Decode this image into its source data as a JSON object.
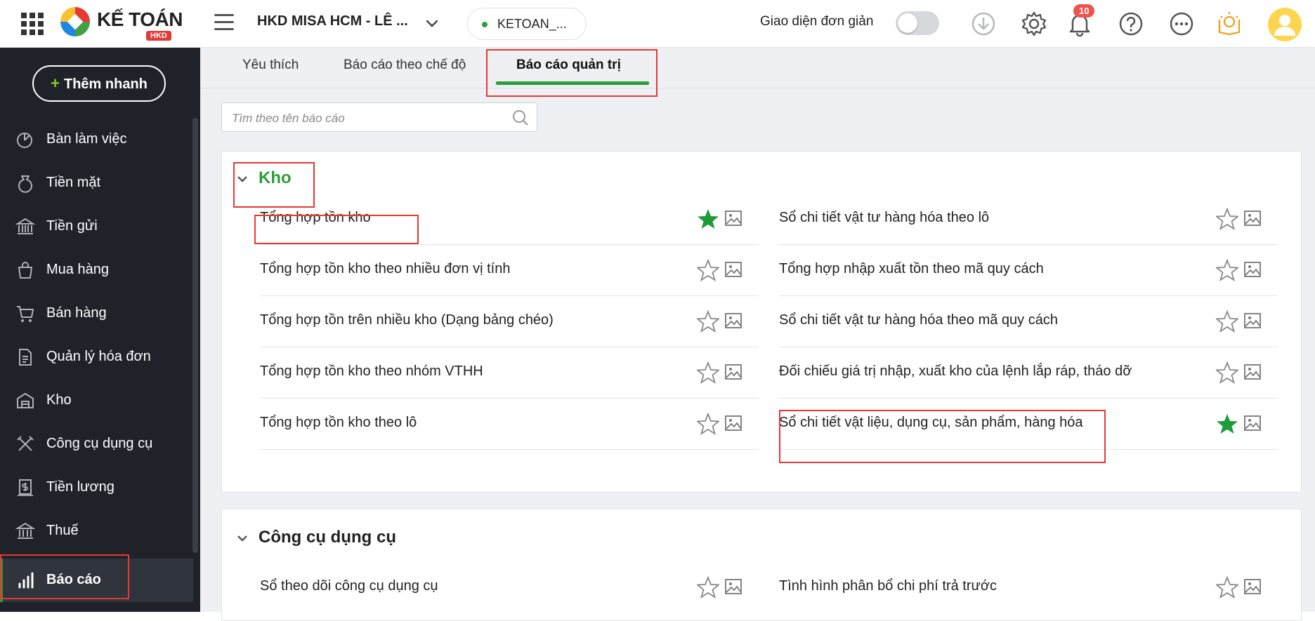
{
  "header": {
    "logo_text": "KẾ TOÁN",
    "logo_badge": "HKD",
    "company_name": "HKD MISA HCM - LÊ ...",
    "database_name": "KETOAN_...",
    "simple_mode_label": "Giao diện đơn giản",
    "notification_count": "10"
  },
  "sidebar": {
    "quick_add": "Thêm nhanh",
    "items": [
      {
        "label": "Bàn làm việc",
        "icon": "dashboard-icon"
      },
      {
        "label": "Tiền mặt",
        "icon": "cash-bag-icon"
      },
      {
        "label": "Tiền gửi",
        "icon": "bank-icon"
      },
      {
        "label": "Mua hàng",
        "icon": "shopping-bag-icon"
      },
      {
        "label": "Bán hàng",
        "icon": "cart-icon"
      },
      {
        "label": "Quản lý hóa đơn",
        "icon": "invoice-icon"
      },
      {
        "label": "Kho",
        "icon": "warehouse-icon"
      },
      {
        "label": "Công cụ dụng cụ",
        "icon": "tools-icon"
      },
      {
        "label": "Tiền lương",
        "icon": "salary-icon"
      },
      {
        "label": "Thuế",
        "icon": "tax-building-icon"
      },
      {
        "label": "Báo cáo",
        "icon": "report-chart-icon",
        "active": true
      }
    ]
  },
  "tabs": [
    {
      "label": "Yêu thích"
    },
    {
      "label": "Báo cáo theo chế độ"
    },
    {
      "label": "Báo cáo quản trị",
      "active": true
    }
  ],
  "search": {
    "placeholder": "Tìm theo tên báo cáo"
  },
  "groups": [
    {
      "title": "Kho",
      "reports_left": [
        {
          "name": "Tổng hợp tồn kho",
          "favorite": true
        },
        {
          "name": "Tổng hợp tồn kho theo nhiều đơn vị tính",
          "favorite": false
        },
        {
          "name": "Tổng hợp tồn trên nhiều kho (Dạng bảng chéo)",
          "favorite": false
        },
        {
          "name": "Tổng hợp tồn kho theo nhóm VTHH",
          "favorite": false
        },
        {
          "name": "Tổng hợp tồn kho theo lô",
          "favorite": false
        }
      ],
      "reports_right": [
        {
          "name": "Sổ chi tiết vật tư hàng hóa theo lô",
          "favorite": false
        },
        {
          "name": "Tổng hợp nhập xuất tồn theo mã quy cách",
          "favorite": false
        },
        {
          "name": "Sổ chi tiết vật tư hàng hóa theo mã quy cách",
          "favorite": false
        },
        {
          "name": "Đối chiếu giá trị nhập, xuất kho của lệnh lắp ráp, tháo dỡ",
          "favorite": false
        },
        {
          "name": "Sổ chi tiết vật liệu, dụng cụ, sản phẩm, hàng hóa",
          "favorite": true
        }
      ]
    },
    {
      "title": "Công cụ dụng cụ",
      "reports_left": [
        {
          "name": "Sổ theo dõi công cụ dụng cụ",
          "favorite": false
        }
      ],
      "reports_right": [
        {
          "name": "Tình hình phân bổ chi phí trả trước",
          "favorite": false
        }
      ]
    }
  ],
  "colors": {
    "accent": "#2e9d3a",
    "sidebar_bg": "#1f2229",
    "highlight": "#e53935"
  }
}
